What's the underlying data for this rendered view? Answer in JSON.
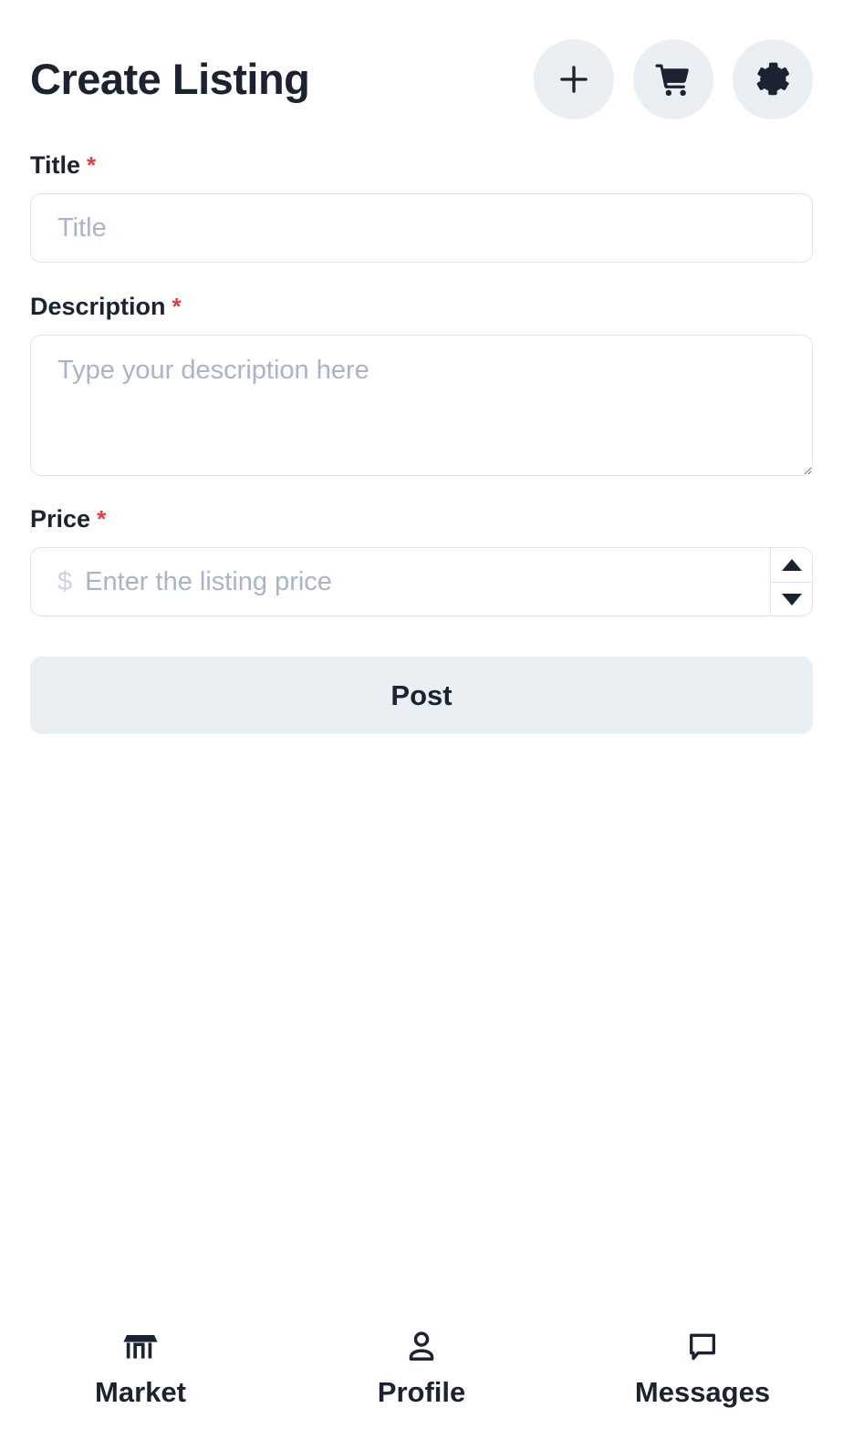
{
  "header": {
    "title": "Create Listing",
    "actions": [
      {
        "name": "add-listing-button",
        "icon": "plus-icon"
      },
      {
        "name": "cart-button",
        "icon": "shopping-cart-icon"
      },
      {
        "name": "settings-button",
        "icon": "gear-icon"
      }
    ]
  },
  "form": {
    "title_field": {
      "label": "Title",
      "required_marker": "*",
      "placeholder": "Title",
      "value": ""
    },
    "description_field": {
      "label": "Description",
      "required_marker": "*",
      "placeholder": "Type your description here",
      "value": ""
    },
    "price_field": {
      "label": "Price",
      "required_marker": "*",
      "currency_symbol": "$",
      "placeholder": "Enter the listing price",
      "value": ""
    },
    "submit_label": "Post"
  },
  "bottom_nav": {
    "items": [
      {
        "label": "Market",
        "icon": "storefront-icon"
      },
      {
        "label": "Profile",
        "icon": "user-icon"
      },
      {
        "label": "Messages",
        "icon": "chat-bubble-icon"
      }
    ]
  },
  "colors": {
    "text_primary": "#1b2230",
    "required_star": "#e03e3e",
    "surface_muted": "#eaeff4",
    "border": "#dfe4ed",
    "placeholder": "#a9b4c6"
  }
}
